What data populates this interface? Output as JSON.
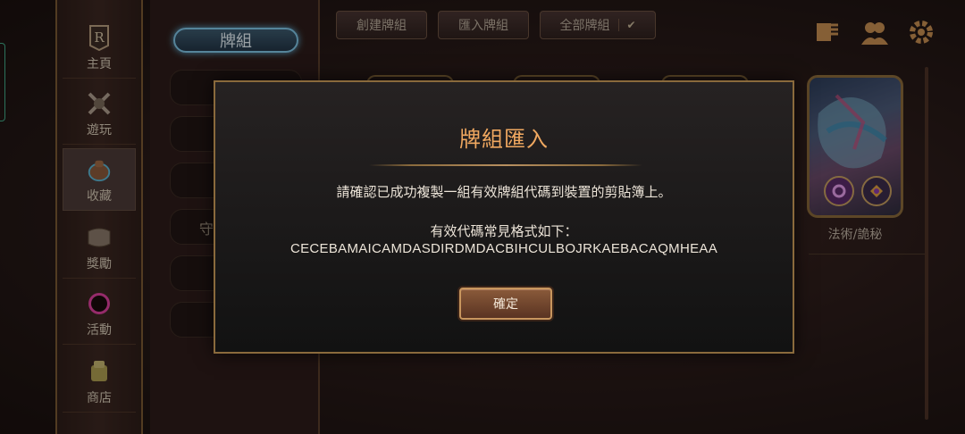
{
  "nav": {
    "items": [
      {
        "label": "主頁",
        "icon": "home-r-icon"
      },
      {
        "label": "遊玩",
        "icon": "crossed-swords-icon"
      },
      {
        "label": "收藏",
        "icon": "backpack-icon"
      },
      {
        "label": "獎勵",
        "icon": "scroll-icon"
      },
      {
        "label": "活動",
        "icon": "eclipse-icon"
      },
      {
        "label": "商店",
        "icon": "treasure-icon"
      }
    ],
    "active_index": 2
  },
  "decks": {
    "tab_label": "牌組",
    "slot_partial_label": "守"
  },
  "toolbar": {
    "create_deck": "創建牌組",
    "import_deck": "匯入牌組",
    "all_decks": "全部牌組",
    "icons": [
      "deck-book-icon",
      "champions-icon",
      "gear-icon"
    ]
  },
  "card": {
    "caption": "法術/詭秘"
  },
  "dialog": {
    "title": "牌組匯入",
    "message": "請確認已成功複製一組有效牌組代碼到裝置的剪貼簿上。",
    "format_label": "有效代碼常見格式如下：",
    "example_code": "CECEBAMAICAMDASDIRDMDACBIHCULBOJRKAEBACAQMHEAA",
    "confirm_label": "確定"
  },
  "colors": {
    "accent_gold": "#8a6a3c",
    "title_orange": "#f0a860",
    "active_tab_blue": "#7fc8ea"
  }
}
